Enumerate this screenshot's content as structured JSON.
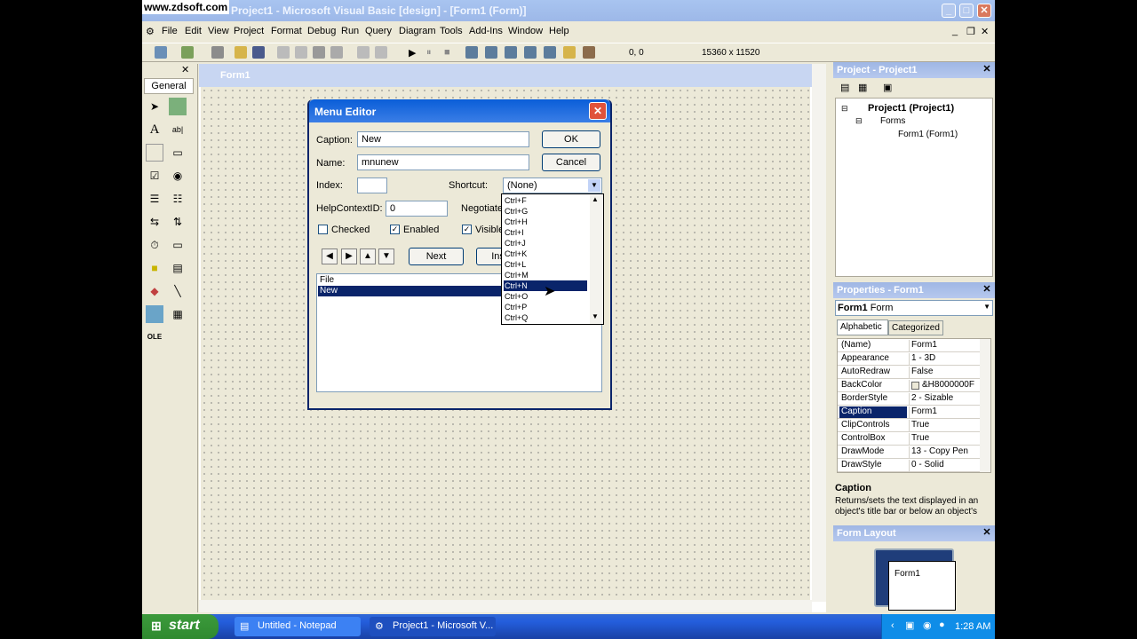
{
  "watermark": "www.zdsoft.com",
  "window": {
    "title": "Project1 - Microsoft Visual Basic [design] - [Form1 (Form)]"
  },
  "menubar": [
    "File",
    "Edit",
    "View",
    "Project",
    "Format",
    "Debug",
    "Run",
    "Query",
    "Diagram",
    "Tools",
    "Add-Ins",
    "Window",
    "Help"
  ],
  "toolbar": {
    "position": "0, 0",
    "size": "15360 x 11520"
  },
  "toolbox": {
    "header": "General"
  },
  "designer": {
    "form_title": "Form1"
  },
  "menu_editor": {
    "title": "Menu Editor",
    "caption_label": "Caption:",
    "caption_value": "New",
    "name_label": "Name:",
    "name_value": "mnunew",
    "index_label": "Index:",
    "index_value": "",
    "shortcut_label": "Shortcut:",
    "shortcut_value": "(None)",
    "helpcontext_label": "HelpContextID:",
    "helpcontext_value": "0",
    "negotiate_label": "Negotiate",
    "checked_label": "Checked",
    "enabled_label": "Enabled",
    "visible_label": "Visible",
    "ok_label": "OK",
    "cancel_label": "Cancel",
    "next_label": "Next",
    "insert_label": "Insert",
    "menu_items": [
      "File",
      "New"
    ],
    "selected_item": "New"
  },
  "shortcut_dropdown": {
    "items": [
      "Ctrl+F",
      "Ctrl+G",
      "Ctrl+H",
      "Ctrl+I",
      "Ctrl+J",
      "Ctrl+K",
      "Ctrl+L",
      "Ctrl+M",
      "Ctrl+N",
      "Ctrl+O",
      "Ctrl+P",
      "Ctrl+Q"
    ],
    "highlighted": "Ctrl+N"
  },
  "project_panel": {
    "title": "Project - Project1",
    "root": "Project1 (Project1)",
    "folder": "Forms",
    "item": "Form1 (Form1)"
  },
  "properties_panel": {
    "title": "Properties - Form1",
    "object": "Form1",
    "object_type": "Form",
    "tab_alpha": "Alphabetic",
    "tab_cat": "Categorized",
    "rows": [
      {
        "name": "(Name)",
        "value": "Form1"
      },
      {
        "name": "Appearance",
        "value": "1 - 3D"
      },
      {
        "name": "AutoRedraw",
        "value": "False"
      },
      {
        "name": "BackColor",
        "value": "&H8000000F"
      },
      {
        "name": "BorderStyle",
        "value": "2 - Sizable"
      },
      {
        "name": "Caption",
        "value": "Form1"
      },
      {
        "name": "ClipControls",
        "value": "True"
      },
      {
        "name": "ControlBox",
        "value": "True"
      },
      {
        "name": "DrawMode",
        "value": "13 - Copy Pen"
      },
      {
        "name": "DrawStyle",
        "value": "0 - Solid"
      }
    ],
    "selected_row": "Caption",
    "desc_title": "Caption",
    "desc_text": "Returns/sets the text displayed in an object's title bar or below an object's"
  },
  "layout_panel": {
    "title": "Form Layout",
    "form_label": "Form1"
  },
  "taskbar": {
    "start_label": "start",
    "tasks": [
      "Untitled - Notepad",
      "Project1 - Microsoft V..."
    ],
    "clock": "1:28 AM"
  },
  "colors": {
    "xp_blue": "#0a5ed8",
    "selection": "#0a246a",
    "start_green": "#3c9a3c"
  }
}
